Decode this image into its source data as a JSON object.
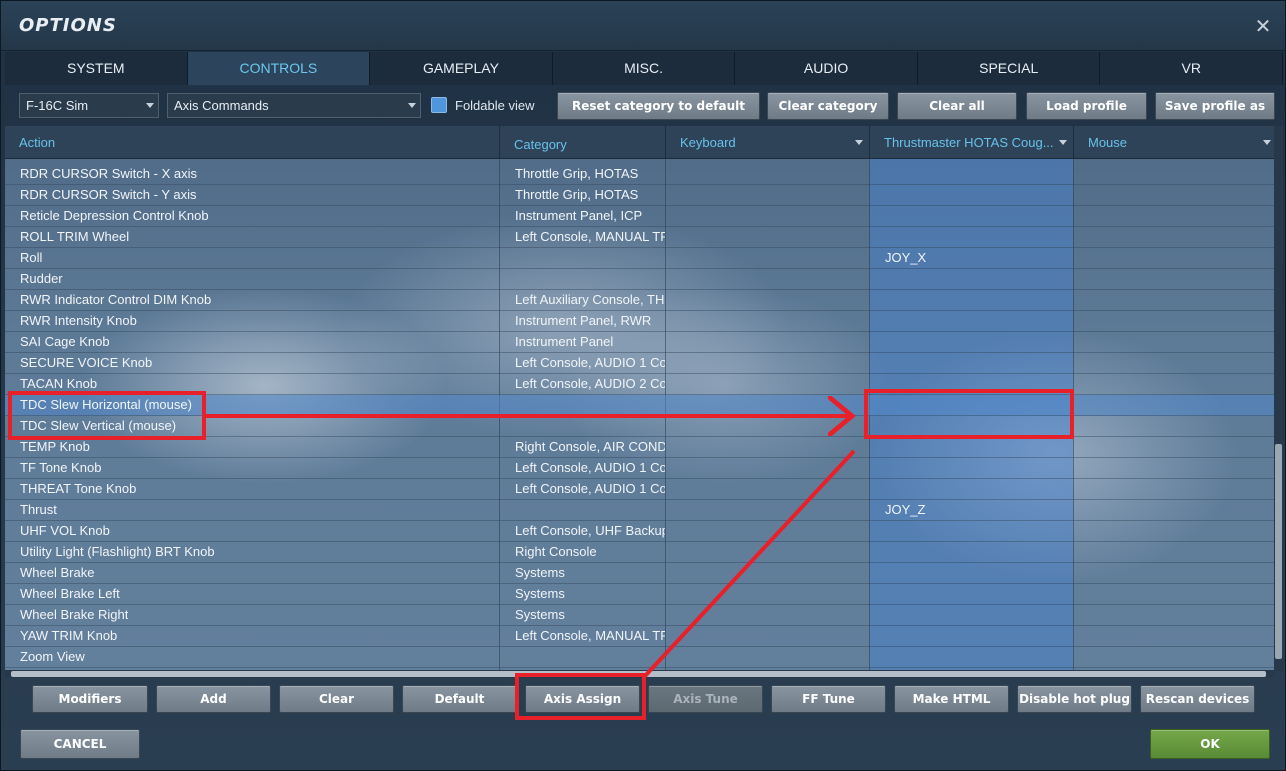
{
  "window": {
    "title": "OPTIONS",
    "close_glyph": "✕"
  },
  "tabs": [
    "SYSTEM",
    "CONTROLS",
    "GAMEPLAY",
    "MISC.",
    "AUDIO",
    "SPECIAL",
    "VR"
  ],
  "active_tab": "CONTROLS",
  "toolbar": {
    "aircraft": "F-16C Sim",
    "category": "Axis Commands",
    "foldable_label": "Foldable view",
    "reset_category": "Reset category to default",
    "clear_category": "Clear category",
    "clear_all": "Clear all",
    "load_profile": "Load profile",
    "save_profile_as": "Save profile as"
  },
  "columns": {
    "action": "Action",
    "category": "Category",
    "keyboard": "Keyboard",
    "hotas": "Thrustmaster HOTAS Coug...",
    "mouse": "Mouse"
  },
  "rows": [
    {
      "action": "RDR CURSOR Switch - X axis",
      "category": "Throttle Grip, HOTAS",
      "keyboard": "",
      "hotas": "",
      "mouse": ""
    },
    {
      "action": "RDR CURSOR Switch - Y axis",
      "category": "Throttle Grip, HOTAS",
      "keyboard": "",
      "hotas": "",
      "mouse": ""
    },
    {
      "action": "Reticle Depression Control Knob",
      "category": "Instrument Panel, ICP",
      "keyboard": "",
      "hotas": "",
      "mouse": ""
    },
    {
      "action": "ROLL TRIM Wheel",
      "category": "Left Console, MANUAL TR",
      "keyboard": "",
      "hotas": "",
      "mouse": ""
    },
    {
      "action": "Roll",
      "category": "",
      "keyboard": "",
      "hotas": "JOY_X",
      "mouse": ""
    },
    {
      "action": "Rudder",
      "category": "",
      "keyboard": "",
      "hotas": "",
      "mouse": ""
    },
    {
      "action": "RWR Indicator Control DIM Knob",
      "category": "Left Auxiliary Console, TH",
      "keyboard": "",
      "hotas": "",
      "mouse": ""
    },
    {
      "action": "RWR Intensity Knob",
      "category": "Instrument Panel, RWR",
      "keyboard": "",
      "hotas": "",
      "mouse": ""
    },
    {
      "action": "SAI Cage Knob",
      "category": "Instrument Panel",
      "keyboard": "",
      "hotas": "",
      "mouse": ""
    },
    {
      "action": "SECURE VOICE Knob",
      "category": "Left Console, AUDIO 1 Co",
      "keyboard": "",
      "hotas": "",
      "mouse": ""
    },
    {
      "action": "TACAN Knob",
      "category": "Left Console, AUDIO 2 Co",
      "keyboard": "",
      "hotas": "",
      "mouse": ""
    },
    {
      "action": "TDC Slew Horizontal (mouse)",
      "category": "",
      "keyboard": "",
      "hotas": "",
      "mouse": "",
      "selected": true
    },
    {
      "action": "TDC Slew Vertical (mouse)",
      "category": "",
      "keyboard": "",
      "hotas": "",
      "mouse": ""
    },
    {
      "action": "TEMP Knob",
      "category": "Right Console, AIR COND",
      "keyboard": "",
      "hotas": "",
      "mouse": ""
    },
    {
      "action": "TF Tone Knob",
      "category": "Left Console, AUDIO 1 Co",
      "keyboard": "",
      "hotas": "",
      "mouse": ""
    },
    {
      "action": "THREAT Tone Knob",
      "category": "Left Console, AUDIO 1 Co",
      "keyboard": "",
      "hotas": "",
      "mouse": ""
    },
    {
      "action": "Thrust",
      "category": "",
      "keyboard": "",
      "hotas": "JOY_Z",
      "mouse": ""
    },
    {
      "action": "UHF VOL Knob",
      "category": "Left Console, UHF Backup",
      "keyboard": "",
      "hotas": "",
      "mouse": ""
    },
    {
      "action": "Utility Light (Flashlight) BRT Knob",
      "category": "Right Console",
      "keyboard": "",
      "hotas": "",
      "mouse": ""
    },
    {
      "action": "Wheel Brake",
      "category": "Systems",
      "keyboard": "",
      "hotas": "",
      "mouse": ""
    },
    {
      "action": "Wheel Brake Left",
      "category": "Systems",
      "keyboard": "",
      "hotas": "",
      "mouse": ""
    },
    {
      "action": "Wheel Brake Right",
      "category": "Systems",
      "keyboard": "",
      "hotas": "",
      "mouse": ""
    },
    {
      "action": "YAW TRIM Knob",
      "category": "Left Console, MANUAL TR",
      "keyboard": "",
      "hotas": "",
      "mouse": ""
    },
    {
      "action": "Zoom View",
      "category": "",
      "keyboard": "",
      "hotas": "",
      "mouse": ""
    }
  ],
  "bottom": {
    "modifiers": "Modifiers",
    "add": "Add",
    "clear": "Clear",
    "default": "Default",
    "axis_assign": "Axis Assign",
    "axis_tune": "Axis Tune",
    "ff_tune": "FF Tune",
    "make_html": "Make HTML",
    "disable_hot_plug": "Disable hot plug",
    "rescan_devices": "Rescan devices"
  },
  "footer": {
    "cancel": "CANCEL",
    "ok": "OK"
  },
  "colors": {
    "accent": "#68c1ec",
    "annotation": "#e8202a",
    "ok_button": "#6a9d40"
  }
}
